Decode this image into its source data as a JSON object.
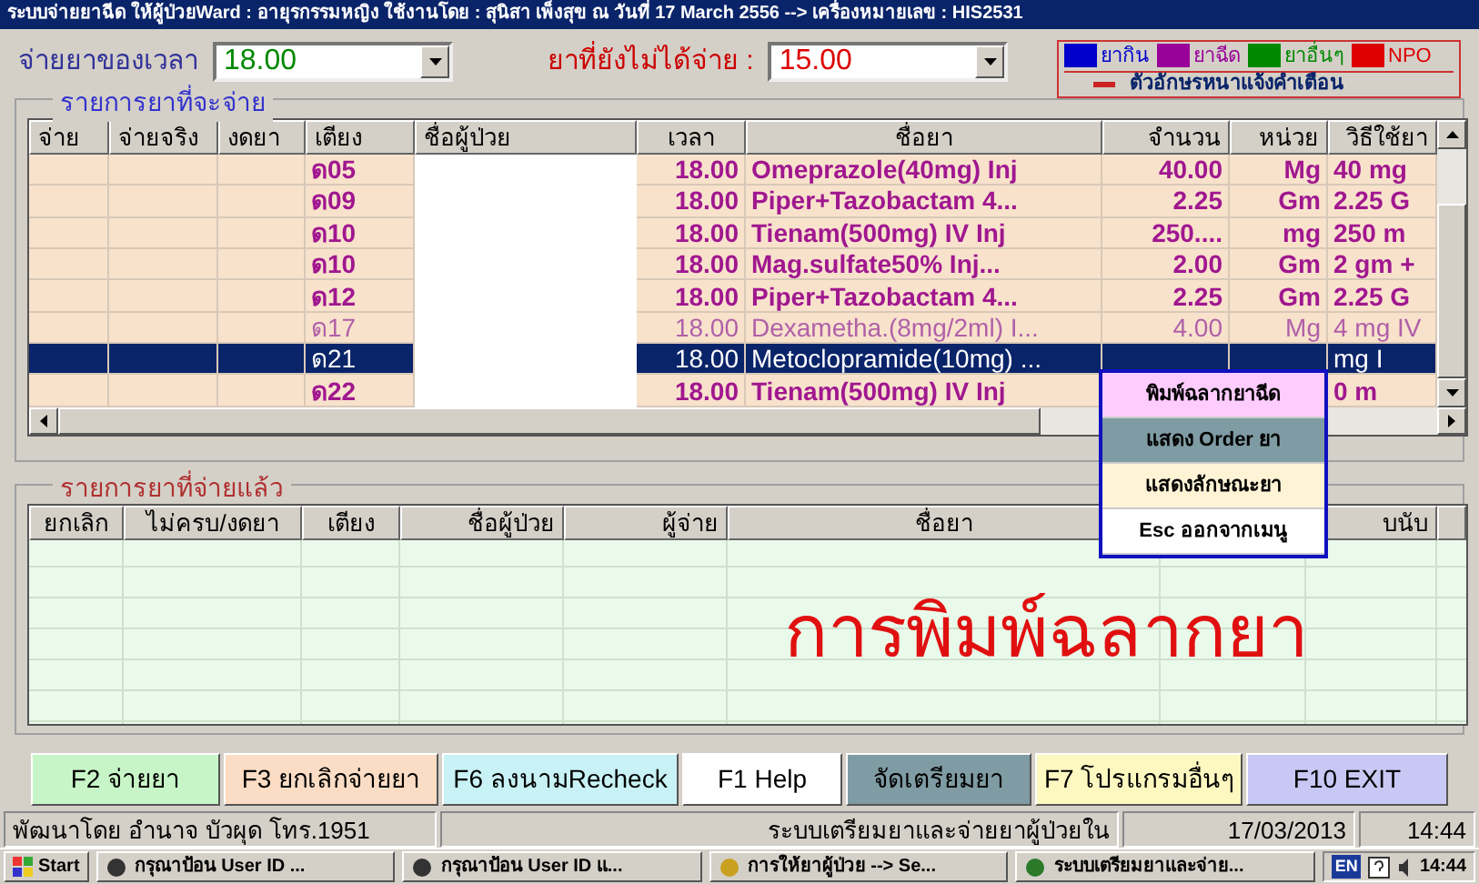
{
  "window": {
    "title": "ระบบจ่ายยาฉีด ให้ผู้ป่วยWard : อายุรกรรมหญิง  ใช้งานโดย : สุนิสา  เพ็งสุข  ณ วันที่  17 March 2556  --> เครื่องหมายเลข : HIS2531"
  },
  "time_field": {
    "label": "จ่ายยาของเวลา",
    "value": "18.00"
  },
  "pending_field": {
    "label": "ยาที่ยังไม่ได้จ่าย  :",
    "value": "15.00"
  },
  "legend": {
    "items": [
      {
        "label": "ยากิน",
        "color": "#0000cc"
      },
      {
        "label": "ยาฉีด",
        "color": "#990099"
      },
      {
        "label": "ยาอื่นๆ",
        "color": "#008800"
      },
      {
        "label": "NPO",
        "color": "#dd0000"
      }
    ],
    "note": "ตัวอักษรหนาแจ้งคำเตือน"
  },
  "pending_table": {
    "title": "รายการยาที่จะจ่าย",
    "columns": [
      "จ่าย",
      "จ่ายจริง",
      "งดยา",
      "เตียง",
      "ชื่อผู้ป่วย",
      "เวลา",
      "ชื่อยา",
      "จำนวน",
      "หน่วย",
      "วิธีใช้ยา"
    ],
    "rows": [
      {
        "bed": "ด05",
        "time": "18.00",
        "drug": "Omeprazole(40mg) Inj",
        "qty": "40.00",
        "unit": "Mg",
        "usage": "40 mg",
        "bold": true,
        "selected": false
      },
      {
        "bed": "ด09",
        "time": "18.00",
        "drug": "Piper+Tazobactam 4...",
        "qty": "2.25",
        "unit": "Gm",
        "usage": "2.25 G",
        "bold": true,
        "selected": false
      },
      {
        "bed": "ด10",
        "time": "18.00",
        "drug": "Tienam(500mg) IV Inj",
        "qty": "250....",
        "unit": "mg",
        "usage": "250 m",
        "bold": true,
        "selected": false
      },
      {
        "bed": "ด10",
        "time": "18.00",
        "drug": "Mag.sulfate50%  Inj...",
        "qty": "2.00",
        "unit": "Gm",
        "usage": "2 gm +",
        "bold": true,
        "selected": false
      },
      {
        "bed": "ด12",
        "time": "18.00",
        "drug": "Piper+Tazobactam 4...",
        "qty": "2.25",
        "unit": "Gm",
        "usage": "2.25 G",
        "bold": true,
        "selected": false
      },
      {
        "bed": "ด17",
        "time": "18.00",
        "drug": "Dexametha.(8mg/2ml) I...",
        "qty": "4.00",
        "unit": "Mg",
        "usage": "4 mg IV",
        "bold": false,
        "selected": false
      },
      {
        "bed": "ด21",
        "time": "18.00",
        "drug": "Metoclopramide(10mg) ...",
        "usage": "mg I",
        "bold": false,
        "selected": true
      },
      {
        "bed": "ด22",
        "time": "18.00",
        "drug": "Tienam(500mg) IV Inj",
        "usage": "0 m",
        "bold": true,
        "selected": false
      }
    ]
  },
  "dispensed_table": {
    "title": "รายการยาที่จ่ายแล้ว",
    "columns": [
      "ยกเลิก",
      "ไม่ครบ/งดยา",
      "เตียง",
      "ชื่อผู้ป่วย",
      "ผู้จ่าย",
      "ชื่อยา",
      "",
      "บนับ"
    ],
    "caption": "การพิมพ์ฉลากยา"
  },
  "context_menu": [
    {
      "label": "พิมพ์ฉลากยาฉีด",
      "color": "#ffccff"
    },
    {
      "label": "แสดง Order ยา",
      "color": "#7f9ba3"
    },
    {
      "label": "แสดงลักษณะยา",
      "color": "#fff3d6"
    },
    {
      "label": "Esc  ออกจากเมนู",
      "color": "#ffffff"
    }
  ],
  "buttons": [
    {
      "label": "F2 จ่ายยา",
      "color": "#c8f5c8"
    },
    {
      "label": "F3 ยกเลิกจ่ายยา",
      "color": "#fbdcc4"
    },
    {
      "label": "F6 ลงนามRecheck",
      "color": "#c8f2f5"
    },
    {
      "label": "F1  Help",
      "color": "#ffffff"
    },
    {
      "label": "จัดเตรียมยา",
      "color": "#7f9ba3"
    },
    {
      "label": "F7 โปรแกรมอื่นๆ",
      "color": "#fdf8c0"
    },
    {
      "label": "F10 EXIT",
      "color": "#c8c8f5"
    }
  ],
  "status_bar": [
    "พัฒนาโดย  อำนาจ  บัวผุด  โทร.1951",
    "ระบบเตรียมยาและจ่ายยาผู้ป่วยใน",
    "17/03/2013",
    "14:44"
  ],
  "taskbar": {
    "start": "Start",
    "tasks": [
      "กรุณาป้อน User ID ...",
      "กรุณาป้อน User ID แ...",
      "การให้ยาผู้ป่วย --> Se...",
      "ระบบเตรียมยาและจ่าย..."
    ],
    "language": "EN",
    "clock": "14:44"
  }
}
